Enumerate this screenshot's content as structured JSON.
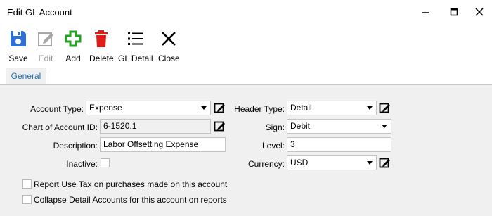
{
  "window": {
    "title": "Edit GL Account"
  },
  "toolbar": {
    "save": "Save",
    "edit": "Edit",
    "add": "Add",
    "delete": "Delete",
    "gl_detail": "GL Detail",
    "close": "Close"
  },
  "tabs": [
    "General"
  ],
  "form": {
    "account_type": {
      "label": "Account Type:",
      "value": "Expense"
    },
    "chart_id": {
      "label": "Chart of Account ID:",
      "value": "6-1520.1"
    },
    "description": {
      "label": "Description:",
      "value": "Labor Offsetting Expense"
    },
    "inactive": {
      "label": "Inactive:",
      "checked": false
    },
    "header_type": {
      "label": "Header Type:",
      "value": "Detail"
    },
    "sign": {
      "label": "Sign:",
      "value": "Debit"
    },
    "level": {
      "label": "Level:",
      "value": "3"
    },
    "currency": {
      "label": "Currency:",
      "value": "USD"
    },
    "report_use_tax": {
      "label": "Report Use Tax on purchases made on this account",
      "checked": false
    },
    "collapse_detail": {
      "label": "Collapse Detail Accounts for this account on reports",
      "checked": false
    }
  },
  "colors": {
    "accent": "#1f6fb5",
    "save": "#2f6fd6",
    "add": "#22a322",
    "delete": "#e01b1b"
  }
}
